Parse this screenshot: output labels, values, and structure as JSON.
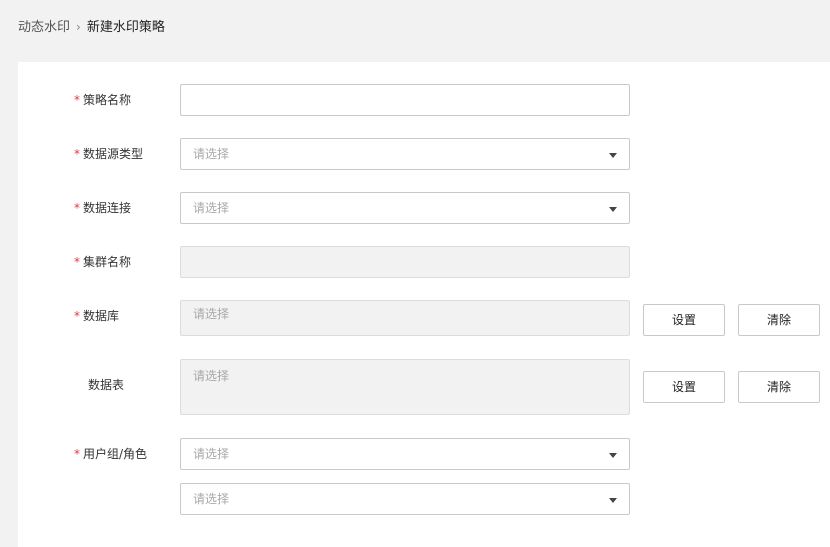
{
  "breadcrumb": {
    "root": "动态水印",
    "separator": "›",
    "current": "新建水印策略"
  },
  "form": {
    "required_mark": "*",
    "policy_name": {
      "label": "策略名称",
      "value": ""
    },
    "datasource_type": {
      "label": "数据源类型",
      "placeholder": "请选择"
    },
    "data_connection": {
      "label": "数据连接",
      "placeholder": "请选择"
    },
    "cluster_name": {
      "label": "集群名称",
      "value": ""
    },
    "database": {
      "label": "数据库",
      "placeholder": "请选择",
      "set_label": "设置",
      "clear_label": "清除"
    },
    "data_table": {
      "label": "数据表",
      "placeholder": "请选择",
      "set_label": "设置",
      "clear_label": "清除"
    },
    "user_group_role": {
      "label": "用户组/角色",
      "placeholder_1": "请选择",
      "placeholder_2": "请选择"
    }
  },
  "colors": {
    "required": "#e4393c",
    "border": "#c7c9cc",
    "disabled_bg": "#f2f2f2",
    "page_bg": "#f2f2f3"
  }
}
